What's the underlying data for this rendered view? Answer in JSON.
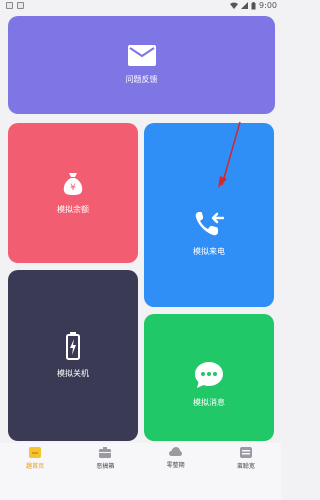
{
  "status_bar": {
    "time": "9:00"
  },
  "cards": {
    "feedback": {
      "label": "问题反馈",
      "icon": "mail-icon"
    },
    "balance": {
      "label": "模拟余额",
      "icon": "money-bag-icon"
    },
    "call": {
      "label": "模拟来电",
      "icon": "incoming-call-icon"
    },
    "shutdown": {
      "label": "模拟关机",
      "icon": "battery-charging-icon"
    },
    "message": {
      "label": "模拟消息",
      "icon": "chat-bubble-icon"
    }
  },
  "bottom_nav": {
    "items": [
      {
        "label": "趣首页",
        "icon": "home-icon",
        "active": true
      },
      {
        "label": "恶搞箱",
        "icon": "toolbox-icon",
        "active": false
      },
      {
        "label": "零整期",
        "icon": "cloud-icon",
        "active": false
      },
      {
        "label": "蛮聪宽",
        "icon": "profile-icon",
        "active": false
      }
    ]
  },
  "colors": {
    "feedback": "#7f76e6",
    "balance": "#f35d71",
    "call": "#2f8ff7",
    "shutdown": "#3a3a55",
    "message": "#20c867",
    "nav_active": "#e0a020",
    "annotation_arrow": "#d2282f"
  }
}
